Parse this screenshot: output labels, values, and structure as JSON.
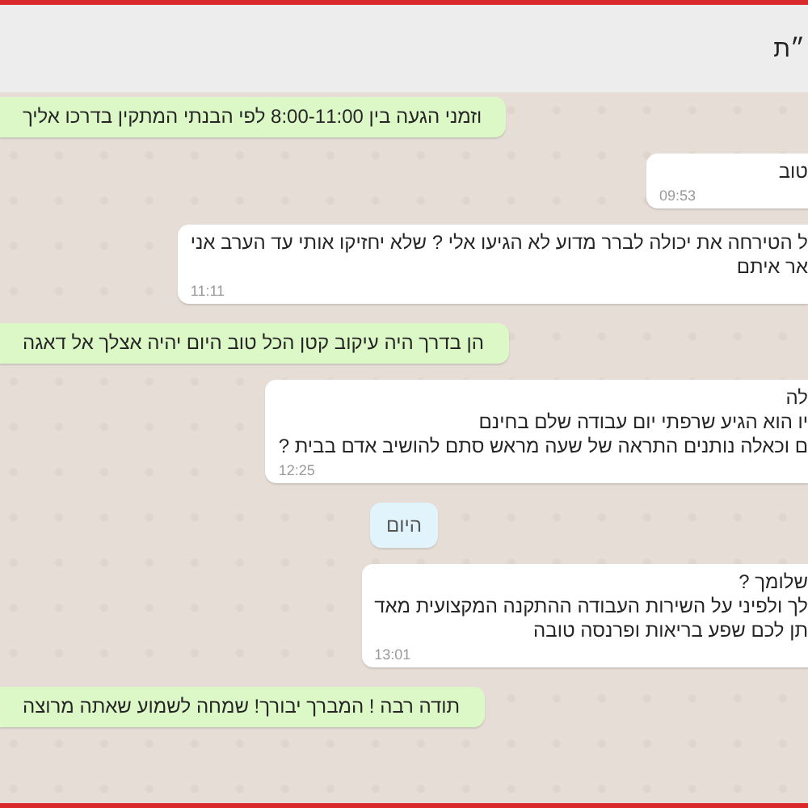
{
  "header": {
    "title": "״ת"
  },
  "messages": [
    {
      "kind": "outgoing",
      "lines": [
        "וזמני הגעה בין 8:00-11:00 לפי הבנתי המתקין בדרכו אליך"
      ]
    },
    {
      "kind": "incoming",
      "lines": [
        "טוב"
      ],
      "time": "09:53"
    },
    {
      "kind": "incoming",
      "lines": [
        "ל הטירחה את יכולה לברר מדוע לא הגיעו אלי ? שלא יחזיקו אותי עד הערב אני",
        "אר איתם"
      ],
      "time": "11:11"
    },
    {
      "kind": "outgoing",
      "lines": [
        "הן בדרך היה עיקוב קטן הכל טוב היום יהיה אצלך אל דאגה"
      ]
    },
    {
      "kind": "incoming",
      "lines": [
        "לה",
        "יו הוא הגיע שרפתי יום עבודה שלם בחינם",
        "ם וכאלה נותנים התראה של שעה מראש סתם להושיב אדם בבית ?"
      ],
      "time": "12:25"
    },
    {
      "kind": "date",
      "lines": [
        "היום"
      ]
    },
    {
      "kind": "incoming",
      "lines": [
        "שלומך ?",
        "לך ולפיני על השירות העבודה ההתקנה המקצועית מאד",
        "תן לכם שפע בריאות ופרנסה טובה"
      ],
      "time": "13:01"
    },
    {
      "kind": "outgoing",
      "lines": [
        "תודה רבה ! המברך יבורך! שמחה לשמוע שאתה מרוצה"
      ]
    }
  ]
}
